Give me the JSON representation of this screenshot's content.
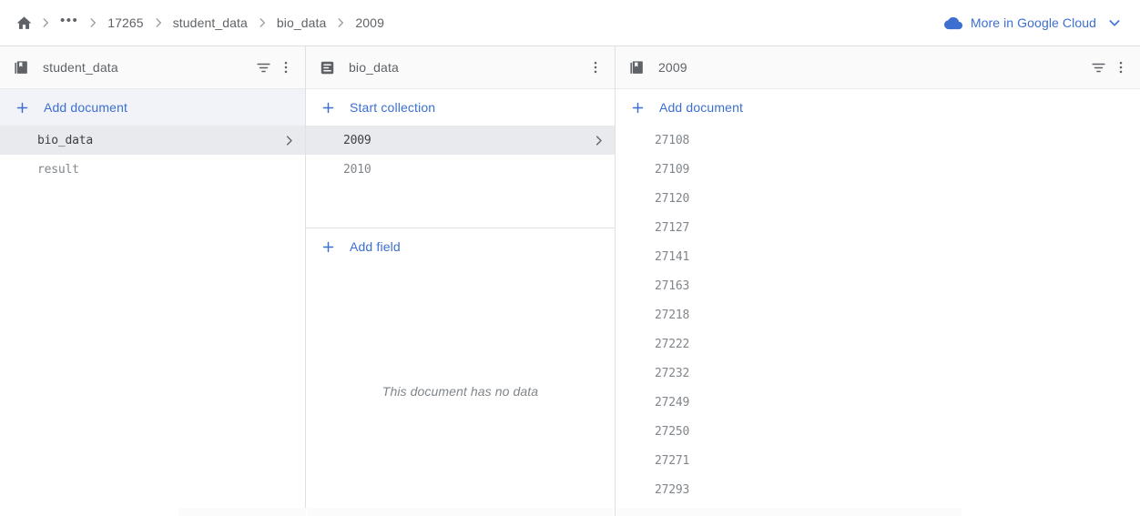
{
  "topbar": {
    "home_icon": "home-icon",
    "ellipsis": "•••",
    "crumbs": [
      "17265",
      "student_data",
      "bio_data",
      "2009"
    ],
    "cloud_link": {
      "icon": "cloud-icon",
      "label": "More in Google Cloud",
      "chevron": "chevron-down-icon",
      "color": "#3c6fd0"
    }
  },
  "columns": [
    {
      "icon": "collection-icon",
      "title": "student_data",
      "actions": [
        "filter-icon",
        "kebab-icon"
      ],
      "add_label": "Add document",
      "add_tinted": true,
      "items": [
        {
          "label": "bio_data",
          "selected": true
        },
        {
          "label": "result",
          "selected": false
        }
      ]
    },
    {
      "icon": "document-icon",
      "title": "bio_data",
      "actions": [
        "kebab-icon"
      ],
      "add_label": "Start collection",
      "add_tinted": false,
      "items": [
        {
          "label": "2009",
          "selected": true
        },
        {
          "label": "2010",
          "selected": false
        }
      ],
      "fields": {
        "add_label": "Add field",
        "empty_text": "This document has no data"
      }
    },
    {
      "icon": "collection-icon",
      "title": "2009",
      "actions": [
        "filter-icon",
        "kebab-icon"
      ],
      "add_label": "Add document",
      "add_tinted": false,
      "items": [
        {
          "label": "27108",
          "selected": false
        },
        {
          "label": "27109",
          "selected": false
        },
        {
          "label": "27120",
          "selected": false
        },
        {
          "label": "27127",
          "selected": false
        },
        {
          "label": "27141",
          "selected": false
        },
        {
          "label": "27163",
          "selected": false
        },
        {
          "label": "27218",
          "selected": false
        },
        {
          "label": "27222",
          "selected": false
        },
        {
          "label": "27232",
          "selected": false
        },
        {
          "label": "27249",
          "selected": false
        },
        {
          "label": "27250",
          "selected": false
        },
        {
          "label": "27271",
          "selected": false
        },
        {
          "label": "27293",
          "selected": false
        }
      ]
    }
  ],
  "colors": {
    "accent": "#3c6fd0",
    "selected_row": "#e8eaed",
    "tinted_row": "#f1f3f9",
    "header_bg": "#fafafa",
    "text_muted": "#80868b"
  }
}
